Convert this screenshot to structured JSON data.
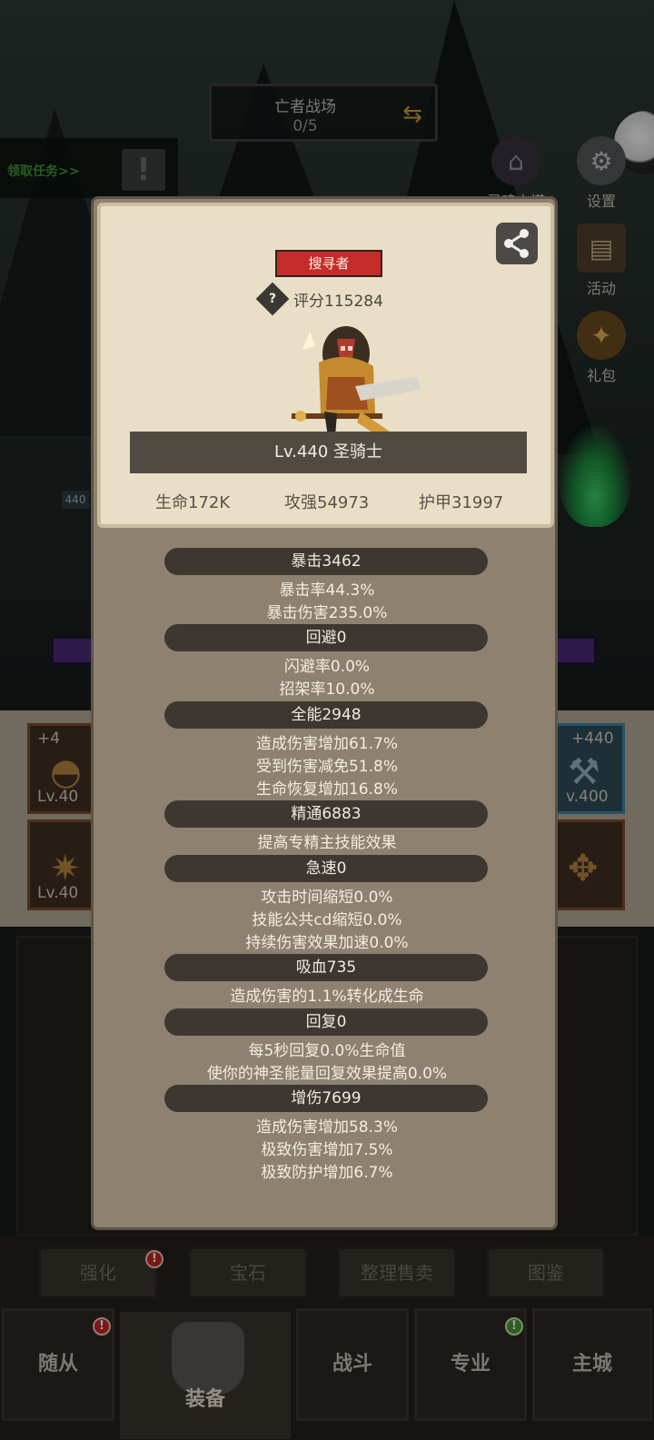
{
  "background": {
    "zone": {
      "title": "亡者战场",
      "progress": "0/5"
    },
    "quest_label": "领取任务>>",
    "side_buttons": [
      {
        "label": "灵魂之塔",
        "icon": "tower-icon"
      },
      {
        "label": "设置",
        "icon": "gear-icon"
      },
      {
        "label": "活动",
        "icon": "scroll-icon"
      },
      {
        "label": "礼包",
        "icon": "gift-icon"
      }
    ],
    "level_tag": "440",
    "equip_slots": [
      {
        "plus": "+4",
        "level": "Lv.40"
      },
      {
        "plus": "",
        "level": "Lv.40"
      },
      {
        "plus": "+440",
        "level": "v.400"
      },
      {
        "plus": "",
        "level": ""
      }
    ],
    "tabs": [
      "强化",
      "宝石",
      "整理售卖",
      "图鉴"
    ],
    "nav": [
      "随从",
      "装备",
      "战斗",
      "专业",
      "主城"
    ]
  },
  "card": {
    "class_tag": "搜寻者",
    "score": "评分115284",
    "name": "Lv.440 圣骑士",
    "hp": "生命172K",
    "attack": "攻强54973",
    "armor": "护甲31997"
  },
  "sections": [
    {
      "head": "暴击3462",
      "lines": [
        "暴击率44.3%",
        "暴击伤害235.0%"
      ]
    },
    {
      "head": "回避0",
      "lines": [
        "闪避率0.0%",
        "招架率10.0%"
      ]
    },
    {
      "head": "全能2948",
      "lines": [
        "造成伤害增加61.7%",
        "受到伤害减免51.8%",
        "生命恢复增加16.8%"
      ]
    },
    {
      "head": "精通6883",
      "lines": [
        "提高专精主技能效果"
      ]
    },
    {
      "head": "急速0",
      "lines": [
        "攻击时间缩短0.0%",
        "技能公共cd缩短0.0%",
        "持续伤害效果加速0.0%"
      ]
    },
    {
      "head": "吸血735",
      "lines": [
        "造成伤害的1.1%转化成生命"
      ]
    },
    {
      "head": "回复0",
      "lines": [
        "每5秒回复0.0%生命值",
        "使你的神圣能量回复效果提高0.0%"
      ]
    },
    {
      "head": "增伤7699",
      "lines": [
        "造成伤害增加58.3%",
        "极致伤害增加7.5%",
        "极致防护增加6.7%"
      ]
    }
  ]
}
